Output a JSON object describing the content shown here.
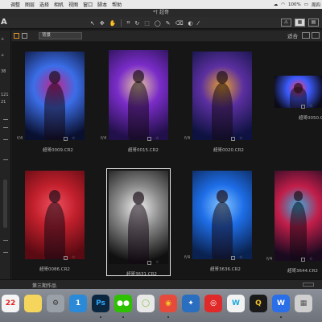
{
  "menubar": {
    "items": [
      "调整",
      "图层",
      "选择",
      "相机",
      "视图",
      "窗口",
      "脚本",
      "帮助"
    ],
    "battery": "100%",
    "clock": "周四"
  },
  "titlebar": {
    "title": "*† 超哥"
  },
  "toolbar": {
    "logo": "A",
    "zoom_label": "适合"
  },
  "browser": {
    "folder": "背景",
    "sort_label": "适合"
  },
  "sidebar": {
    "labels": [
      "38",
      "121",
      "21"
    ]
  },
  "thumbnails": [
    {
      "name": "超哥0009.CR2",
      "fstop": "f/4",
      "bg": [
        "#0a1030",
        "#3b6ee8",
        "#c2248a"
      ]
    },
    {
      "name": "超哥0015.CR2",
      "fstop": "f/4",
      "bg": [
        "#22104a",
        "#7a2cc8",
        "#e7c7a0"
      ]
    },
    {
      "name": "超哥0020.CR2",
      "fstop": "f/4",
      "bg": [
        "#0e1240",
        "#5b2fa0",
        "#e9a22a"
      ]
    },
    {
      "name": "超哥0050.CR2",
      "fstop": "",
      "bg": [
        "#0b0b1a",
        "#3d5cff",
        "#ff3d6b"
      ]
    },
    {
      "name": "超哥0086.CR2",
      "fstop": "",
      "bg": [
        "#5a0a12",
        "#c2202c",
        "#f05060"
      ]
    },
    {
      "name": "超哥3631.CR2",
      "fstop": "",
      "bg": [
        "#101010",
        "#8a8a8a",
        "#f0f0f0"
      ]
    },
    {
      "name": "超哥3636.CR2",
      "fstop": "f/4",
      "bg": [
        "#0a2250",
        "#1e6ee8",
        "#86c7ff"
      ]
    },
    {
      "name": "超哥3644.CR2",
      "fstop": "f/4",
      "bg": [
        "#1a0a20",
        "#c21e4a",
        "#36b0e0"
      ]
    }
  ],
  "status": {
    "label": "第三期作品"
  },
  "dock": {
    "icons": [
      {
        "name": "calendar-icon",
        "glyph": "22",
        "color": "#f4f4f4",
        "text": "#e02020"
      },
      {
        "name": "notes-icon",
        "glyph": "",
        "color": "#f6d55c",
        "text": "#333"
      },
      {
        "name": "system-preferences-icon",
        "glyph": "⚙",
        "color": "#9aa0a8",
        "text": "#333"
      },
      {
        "name": "1password-icon",
        "glyph": "1",
        "color": "#2a8ad8",
        "text": "#fff"
      },
      {
        "name": "photoshop-icon",
        "glyph": "Ps",
        "color": "#0b2740",
        "text": "#31a8ff"
      },
      {
        "name": "wechat-icon",
        "glyph": "●●",
        "color": "#2dc100",
        "text": "#fff"
      },
      {
        "name": "app-circle-icon",
        "glyph": "◯",
        "color": "#e8e8e8",
        "text": "#7bbf2a"
      },
      {
        "name": "chrome-icon",
        "glyph": "◉",
        "color": "#e64a3a",
        "text": "#f6c42a"
      },
      {
        "name": "paw-app-icon",
        "glyph": "✦",
        "color": "#2a6ec0",
        "text": "#fff"
      },
      {
        "name": "netease-music-icon",
        "glyph": "◎",
        "color": "#e02a2a",
        "text": "#fff"
      },
      {
        "name": "w-app-icon",
        "glyph": "W",
        "color": "#f2f2f2",
        "text": "#1ba9e0"
      },
      {
        "name": "qq-icon",
        "glyph": "Q",
        "color": "#1a1a1a",
        "text": "#f6c42a"
      },
      {
        "name": "wps-icon",
        "glyph": "W",
        "color": "#2a6ee8",
        "text": "#fff"
      },
      {
        "name": "screenshot-app-icon",
        "glyph": "▦",
        "color": "#cfcfcf",
        "text": "#555"
      }
    ]
  }
}
